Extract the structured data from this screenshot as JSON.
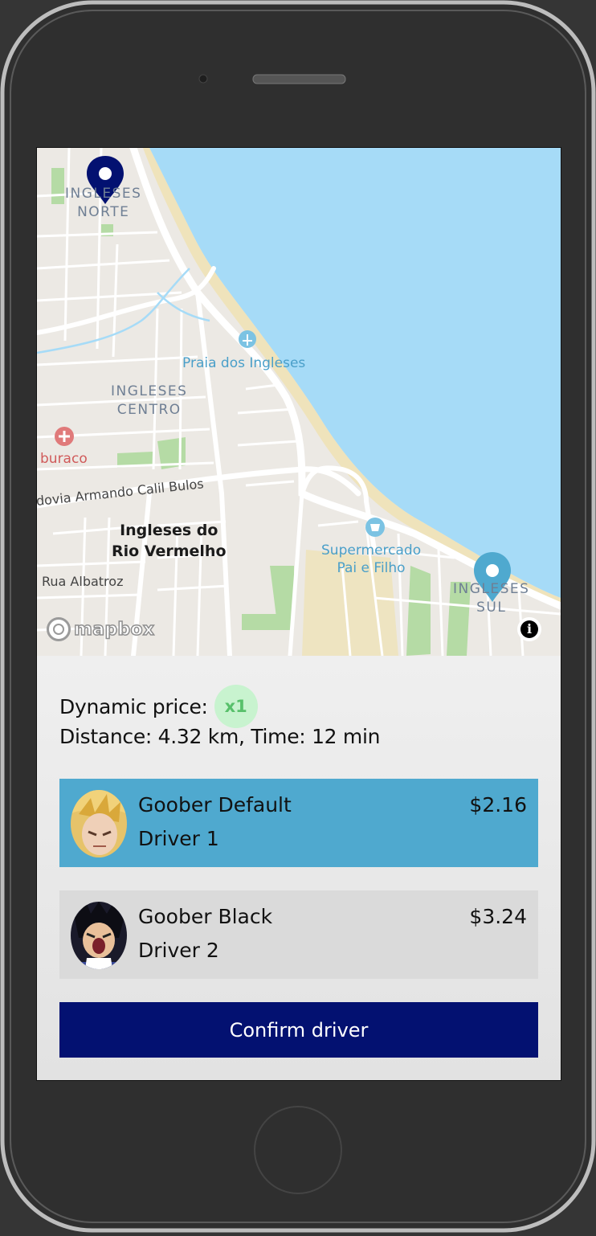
{
  "map": {
    "labels": {
      "ingleses_norte": "INGLESES\nNORTE",
      "praia": "Praia dos Ingleses",
      "ingleses_centro": "INGLESES\nCENTRO",
      "buraco": "buraco",
      "rodovia": "dovia Armando Calil Bulos",
      "rio_vermelho": "Ingleses do\nRio Vermelho",
      "supermercado": "Supermercado\nPai e Filho",
      "rua_albatroz": "Rua Albatroz",
      "ingleses_sul": "INGLESES\nSUL"
    },
    "attribution_logo": "mapbox",
    "info_icon": "i",
    "colors": {
      "water": "#a6dbf7",
      "land": "#ece9e4",
      "park": "#b5dba5",
      "beach": "#efe3bb",
      "road": "#ffffff"
    },
    "origin_pin_color": "#031171",
    "destination_pin_color": "#4fa9cf"
  },
  "trip": {
    "dynamic_price_label": "Dynamic price:",
    "dynamic_multiplier": "x1",
    "distance_time": "Distance: 4.32 km, Time: 12 min"
  },
  "drivers": [
    {
      "service": "Goober Default",
      "driver": "Driver 1",
      "price": "$2.16",
      "selected": true
    },
    {
      "service": "Goober Black",
      "driver": "Driver 2",
      "price": "$3.24",
      "selected": false
    }
  ],
  "confirm_label": "Confirm driver",
  "colors": {
    "selected_card": "#4fa9cf",
    "card": "#dadada",
    "confirm": "#031171",
    "badge_bg": "#c8f3cf",
    "badge_text": "#58c06b"
  }
}
